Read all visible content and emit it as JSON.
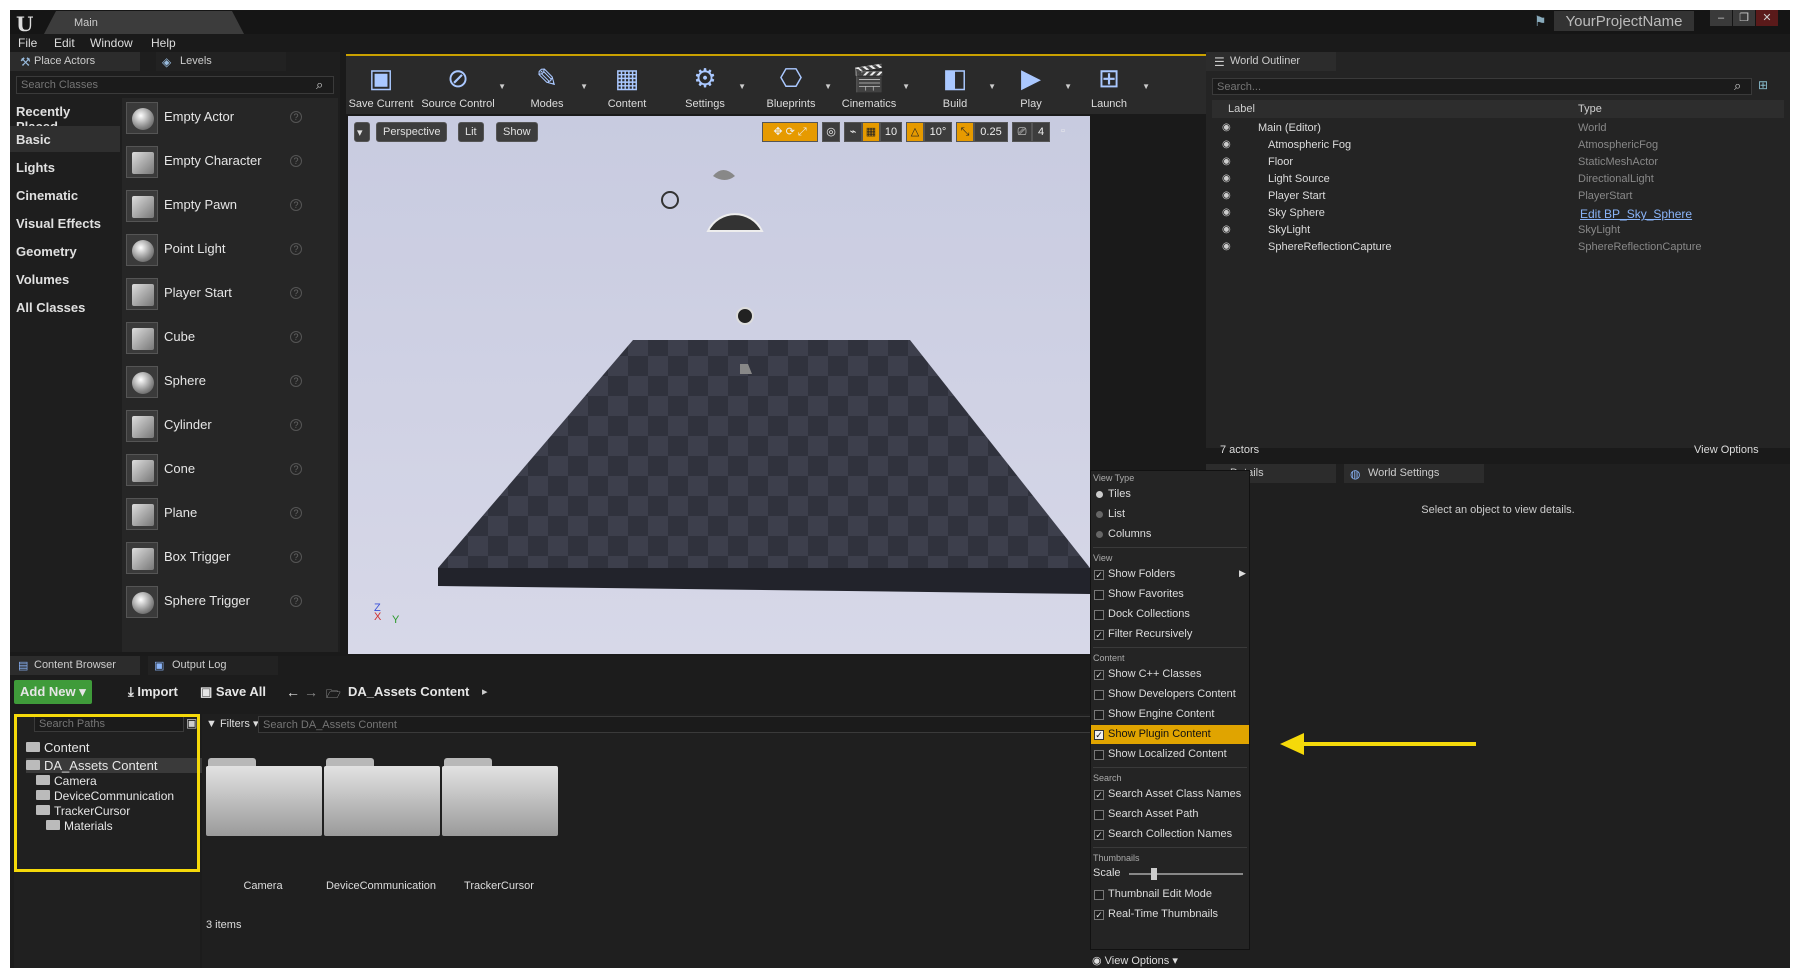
{
  "title_bar": {
    "tab": "Main",
    "project": "YourProjectName"
  },
  "menu": [
    "File",
    "Edit",
    "Window",
    "Help"
  ],
  "place_actors": {
    "tabs": [
      "Place Actors",
      "Levels"
    ],
    "search_placeholder": "Search Classes",
    "categories": [
      "Recently Placed",
      "Basic",
      "Lights",
      "Cinematic",
      "Visual Effects",
      "Geometry",
      "Volumes",
      "All Classes"
    ],
    "selected_category": "Basic",
    "items": [
      "Empty Actor",
      "Empty Character",
      "Empty Pawn",
      "Point Light",
      "Player Start",
      "Cube",
      "Sphere",
      "Cylinder",
      "Cone",
      "Plane",
      "Box Trigger",
      "Sphere Trigger"
    ]
  },
  "toolbar": [
    "Save Current",
    "Source Control",
    "Modes",
    "Content",
    "Settings",
    "Blueprints",
    "Cinematics",
    "Build",
    "Play",
    "Launch"
  ],
  "viewport": {
    "buttons": [
      "Perspective",
      "Lit",
      "Show"
    ],
    "grid": "10",
    "rotation": "10°",
    "scale": "0.25",
    "camera_speed": "4",
    "axes": [
      "Z",
      "X",
      "Y"
    ]
  },
  "world_outliner": {
    "tab": "World Outliner",
    "search_placeholder": "Search...",
    "columns": [
      "Label",
      "Type"
    ],
    "rows": [
      {
        "label": "Main (Editor)",
        "type": "World"
      },
      {
        "label": "Atmospheric Fog",
        "type": "AtmosphericFog"
      },
      {
        "label": "Floor",
        "type": "StaticMeshActor"
      },
      {
        "label": "Light Source",
        "type": "DirectionalLight"
      },
      {
        "label": "Player Start",
        "type": "PlayerStart"
      },
      {
        "label": "Sky Sphere",
        "type": "Edit BP_Sky_Sphere"
      },
      {
        "label": "SkyLight",
        "type": "SkyLight"
      },
      {
        "label": "SphereReflectionCapture",
        "type": "SphereReflectionCapture"
      }
    ],
    "count": "7 actors",
    "view_options": "View Options"
  },
  "details": {
    "tabs": [
      "Details",
      "World Settings"
    ],
    "empty": "Select an object to view details."
  },
  "view_options_menu": {
    "view_type_header": "View Type",
    "view_type": [
      "Tiles",
      "List",
      "Columns"
    ],
    "view_header": "View",
    "view": [
      {
        "label": "Show Folders",
        "checked": true
      },
      {
        "label": "Show Favorites",
        "checked": false
      },
      {
        "label": "Dock Collections",
        "checked": false
      },
      {
        "label": "Filter Recursively",
        "checked": true
      }
    ],
    "content_header": "Content",
    "content": [
      {
        "label": "Show C++ Classes",
        "checked": true
      },
      {
        "label": "Show Developers Content",
        "checked": false
      },
      {
        "label": "Show Engine Content",
        "checked": false
      },
      {
        "label": "Show Plugin Content",
        "checked": true
      },
      {
        "label": "Show Localized Content",
        "checked": false
      }
    ],
    "search_header": "Search",
    "search": [
      {
        "label": "Search Asset Class Names",
        "checked": true
      },
      {
        "label": "Search Asset Path",
        "checked": false
      },
      {
        "label": "Search Collection Names",
        "checked": true
      }
    ],
    "thumbnails_header": "Thumbnails",
    "scale_label": "Scale",
    "scale_value": 0.2,
    "thumbnails": [
      {
        "label": "Thumbnail Edit Mode",
        "checked": false
      },
      {
        "label": "Real-Time Thumbnails",
        "checked": true
      }
    ],
    "footer": "View Options"
  },
  "content_browser": {
    "tabs": [
      "Content Browser",
      "Output Log"
    ],
    "add_new": "Add New",
    "import": "Import",
    "save_all": "Save All",
    "path": "DA_Assets Content",
    "search_paths_placeholder": "Search Paths",
    "filters": "Filters",
    "search_placeholder": "Search DA_Assets Content",
    "tree": [
      "Content",
      "DA_Assets Content",
      "Camera",
      "DeviceCommunication",
      "TrackerCursor",
      "Materials"
    ],
    "folders": [
      "Camera",
      "DeviceCommunication",
      "TrackerCursor"
    ],
    "items_count": "3 items"
  },
  "colors": {
    "highlight": "#f5d90a",
    "menu_selected": "#e0a400",
    "add_new": "#3f9b3a"
  }
}
